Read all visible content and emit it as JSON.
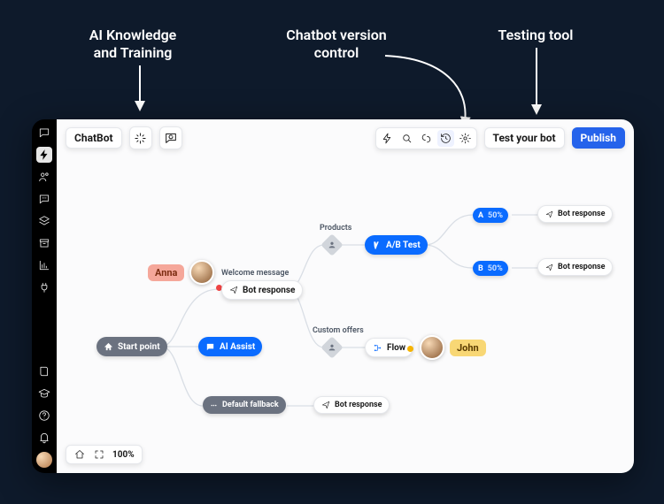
{
  "annotations": {
    "knowledge": "AI Knowledge\nand Training",
    "version": "Chatbot version\ncontrol",
    "test": "Testing tool"
  },
  "sidebar": {
    "top": [
      "chat",
      "bolt",
      "users",
      "cloud",
      "layers",
      "archive",
      "chart",
      "plug"
    ],
    "bottom": [
      "book",
      "education",
      "help",
      "bell"
    ]
  },
  "toolbar": {
    "title": "ChatBot",
    "ai_btn": "sparkle",
    "reset_btn": "refresh-chat",
    "group": [
      "bolt",
      "search",
      "form",
      "history",
      "gear"
    ],
    "active_group": "history",
    "test_label": "Test your bot",
    "publish_label": "Publish"
  },
  "flow": {
    "start": "Start point",
    "ai_assist": "AI Assist",
    "default_fallback": "Default fallback",
    "welcome_label": "Welcome message",
    "bot_response": "Bot response",
    "products_label": "Products",
    "custom_label": "Custom offers",
    "ab_test": "A/B Test",
    "variant_a": "A",
    "variant_b": "B",
    "variant_pct": "50%",
    "flow": "Flow",
    "user_anna": "Anna",
    "user_john": "John"
  },
  "zoom": {
    "level": "100%"
  }
}
